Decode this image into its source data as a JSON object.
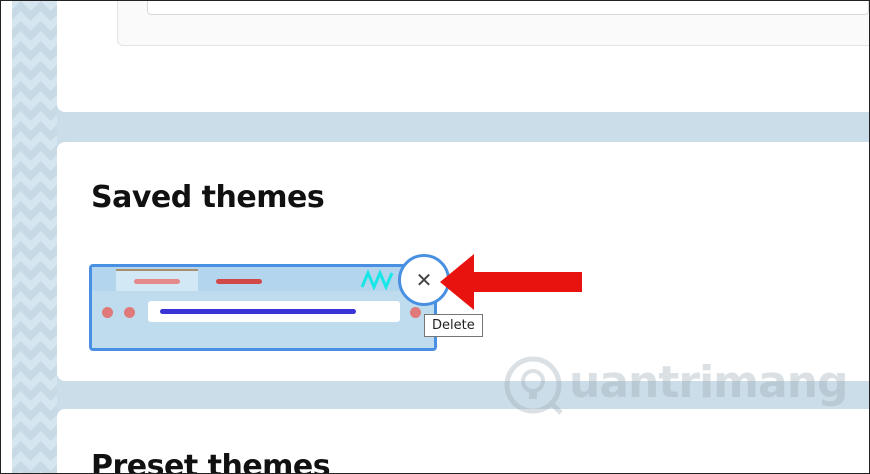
{
  "sections": {
    "saved_title": "Saved themes",
    "preset_title": "Preset themes"
  },
  "saved_theme": {
    "close_icon": "close-icon",
    "tooltip": "Delete"
  },
  "annotation": {
    "arrow_color": "#e8120e",
    "highlight_color": "#4a90e2"
  },
  "watermark": {
    "text": "uantrimang"
  }
}
